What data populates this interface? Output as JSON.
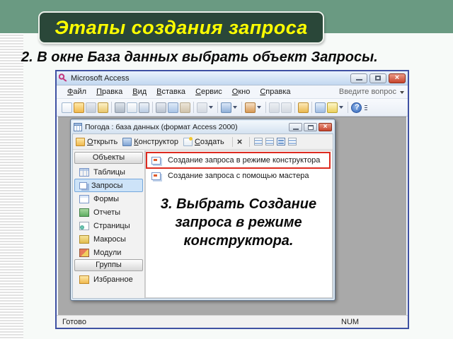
{
  "slide": {
    "title": "Этапы создания запроса",
    "step2_text": "2. В окне База данных выбрать объект Запросы.",
    "step3_text": "3. Выбрать Создание запроса в режиме конструктора."
  },
  "colors": {
    "top_band": "#6a9a82",
    "banner_bg": "#2a4739",
    "banner_text": "#ffff00",
    "highlight_red": "#dd2b1f",
    "selection_blue": "#cde3f8"
  },
  "access": {
    "window_title": "Microsoft Access",
    "menu_items": [
      "Файл",
      "Правка",
      "Вид",
      "Вставка",
      "Сервис",
      "Окно",
      "Справка"
    ],
    "ask_question": "Введите вопрос",
    "toolbar_icons": [
      "new",
      "open",
      "save",
      "dbutils",
      "sep",
      "print",
      "preview",
      "spell",
      "sep",
      "cut",
      "copy",
      "paste",
      "sep",
      "undo",
      "dd",
      "sep",
      "officelinks",
      "dd",
      "sep",
      "analyze",
      "dd",
      "sep",
      "script",
      "hyperlink",
      "sep",
      "props",
      "sep",
      "relations",
      "newobj",
      "dd",
      "sep",
      "help",
      "overflow"
    ],
    "status_left": "Готово",
    "status_right": "NUM"
  },
  "db_window": {
    "title": "Погода : база данных (формат Access 2000)",
    "toolbar": {
      "open_label": "Открыть",
      "design_label": "Конструктор",
      "new_label": "Создать"
    },
    "objects_header": "Объекты",
    "objects": [
      {
        "label": "Таблицы",
        "icon": "table"
      },
      {
        "label": "Запросы",
        "icon": "query"
      },
      {
        "label": "Формы",
        "icon": "form"
      },
      {
        "label": "Отчеты",
        "icon": "report"
      },
      {
        "label": "Страницы",
        "icon": "page"
      },
      {
        "label": "Макросы",
        "icon": "macro"
      },
      {
        "label": "Модули",
        "icon": "module"
      }
    ],
    "selected_object": "Запросы",
    "groups_header": "Группы",
    "groups": [
      {
        "label": "Избранное",
        "icon": "folder"
      }
    ],
    "list_items": [
      "Создание запроса в режиме конструктора",
      "Создание запроса с помощью мастера"
    ],
    "highlighted_item_index": 0
  }
}
